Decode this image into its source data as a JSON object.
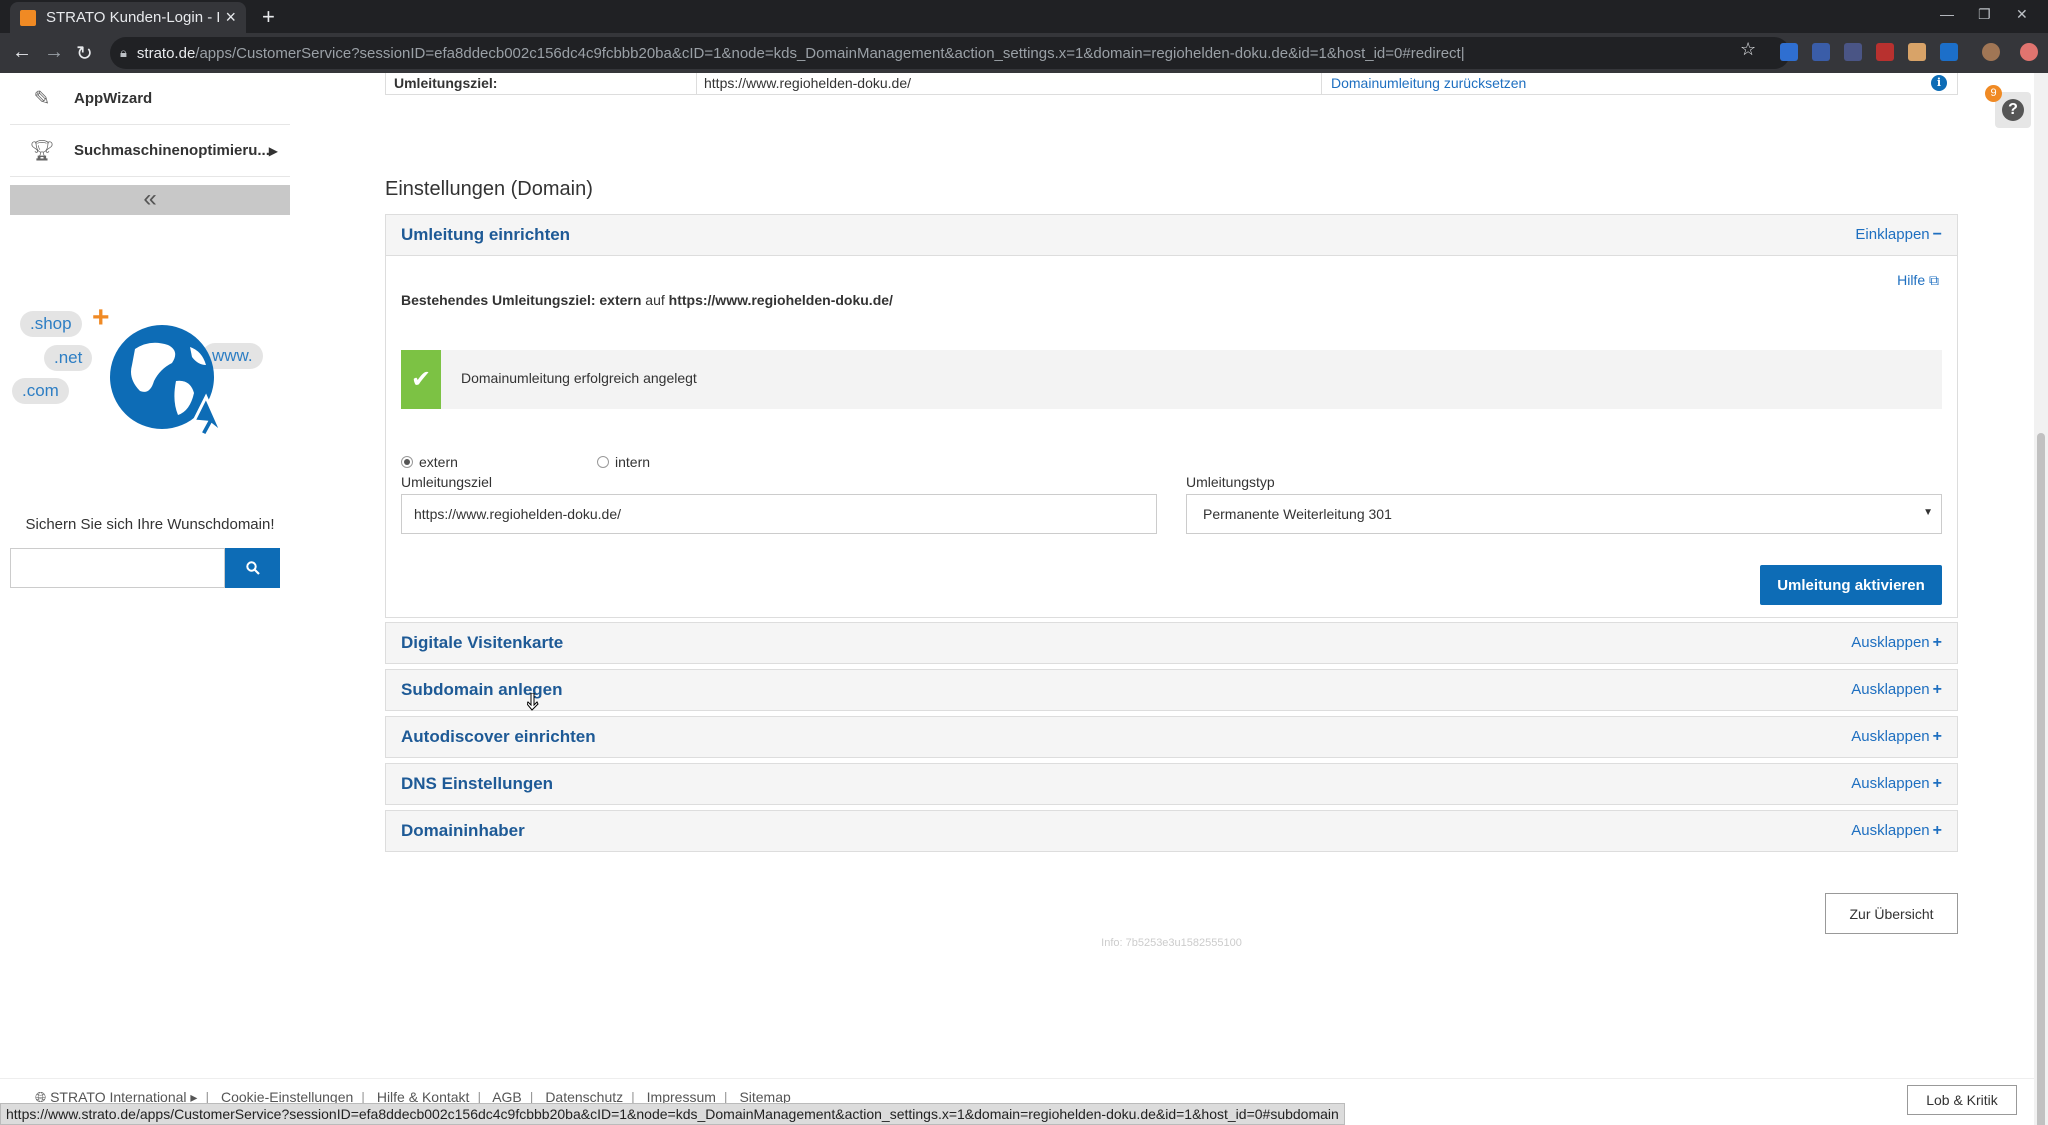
{
  "browser": {
    "tab_title": "STRATO Kunden-Login - D",
    "url_host": "strato.de",
    "url_path": "/apps/CustomerService?sessionID=efa8ddecb002c156dc4c9fcbbb20ba&cID=1&node=kds_DomainManagement&action_settings.x=1&domain=regiohelden-doku.de&id=1&host_id=0#redirect|",
    "status_url": "https://www.strato.de/apps/CustomerService?sessionID=efa8ddecb002c156dc4c9fcbbb20ba&cID=1&node=kds_DomainManagement&action_settings.x=1&domain=regiohelden-doku.de&id=1&host_id=0#subdomain"
  },
  "sidebar": {
    "items": [
      {
        "label": "AppWizard",
        "icon": "magic-wand-icon"
      },
      {
        "label": "Suchmaschinenoptimieru...",
        "icon": "trophy-icon"
      }
    ],
    "collapse_label": "«",
    "promo": {
      "bubbles": [
        ".shop",
        ".net",
        ".com",
        "www."
      ],
      "text": "Sichern Sie sich Ihre Wunschdomain!",
      "search_placeholder": ""
    }
  },
  "top_row": {
    "label": "Umleitungsziel:",
    "value": "https://www.regiohelden-doku.de/",
    "reset_link": "Domainumleitung zurücksetzen"
  },
  "section_title": "Einstellungen (Domain)",
  "redirect_panel": {
    "title": "Umleitung einrichten",
    "toggle": "Einklappen",
    "help": "Hilfe",
    "existing_prefix": "Bestehendes Umleitungsziel: extern",
    "existing_mid": "auf",
    "existing_url": "https://www.regiohelden-doku.de/",
    "success_msg": "Domainumleitung erfolgreich angelegt",
    "radio_extern": "extern",
    "radio_intern": "intern",
    "target_label": "Umleitungsziel",
    "target_value": "https://www.regiohelden-doku.de/",
    "type_label": "Umleitungstyp",
    "type_value": "Permanente Weiterleitung 301",
    "activate_label": "Umleitung aktivieren"
  },
  "collapsed_panels": [
    {
      "title": "Digitale Visitenkarte",
      "toggle": "Ausklappen"
    },
    {
      "title": "Subdomain anlegen",
      "toggle": "Ausklappen"
    },
    {
      "title": "Autodiscover einrichten",
      "toggle": "Ausklappen"
    },
    {
      "title": "DNS Einstellungen",
      "toggle": "Ausklappen"
    },
    {
      "title": "Domaininhaber",
      "toggle": "Ausklappen"
    }
  ],
  "overview_label": "Zur Übersicht",
  "info_footer": "Info: 7b5253e3u1582555100",
  "notification_count": "9",
  "footer": {
    "links": [
      "STRATO International ▸",
      "Cookie-Einstellungen",
      "Hilfe & Kontakt",
      "AGB",
      "Datenschutz",
      "Impressum",
      "Sitemap"
    ],
    "feedback": "Lob & Kritik"
  },
  "colors": {
    "accent": "#0d6cb6",
    "success": "#7cc244",
    "link": "#1e6fc0"
  }
}
